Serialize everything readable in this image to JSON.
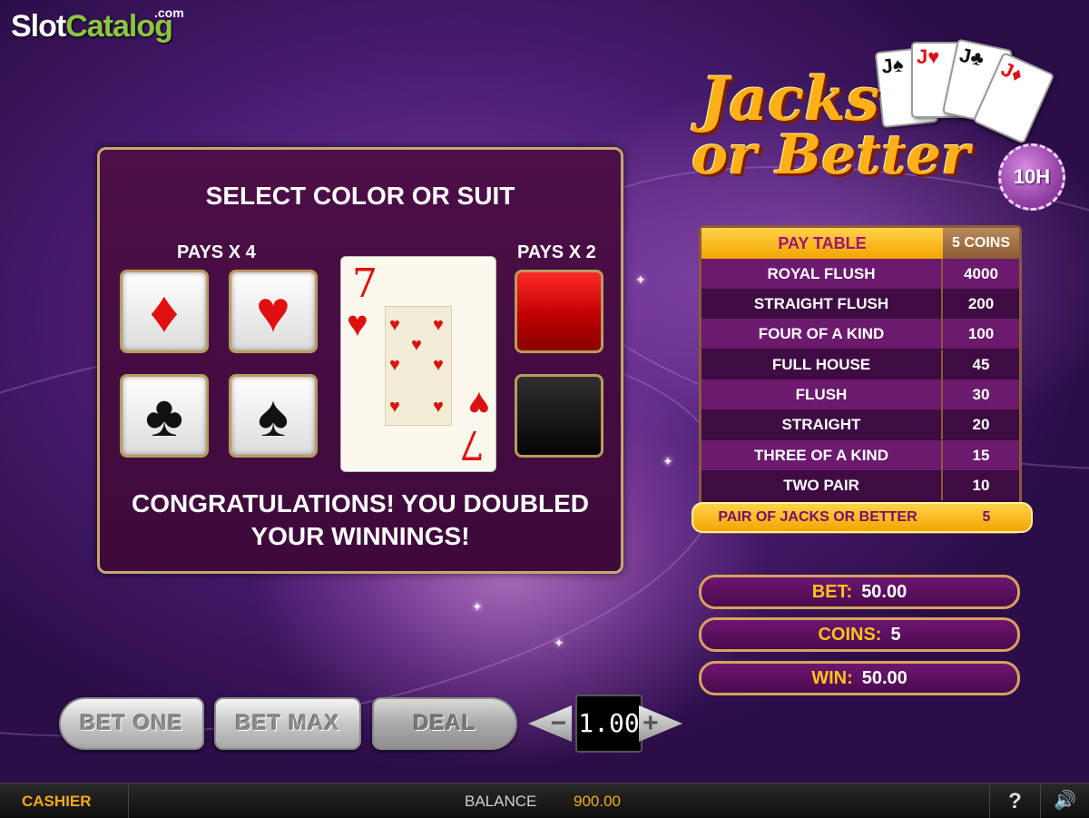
{
  "branding": {
    "logo_part1": "Slot",
    "logo_part2": "Catalog",
    "logo_suffix": ".com"
  },
  "game": {
    "title_line1": "Jacks",
    "title_line2": "or Better",
    "badge": "10H",
    "fan_card_ranks": [
      "J",
      "J",
      "J",
      "J"
    ]
  },
  "double_up": {
    "title": "SELECT COLOR OR SUIT",
    "pays_suit": "PAYS X 4",
    "pays_color": "PAYS X 2",
    "suits": [
      {
        "name": "diamonds",
        "glyph": "♦",
        "color": "#e01010"
      },
      {
        "name": "hearts",
        "glyph": "♥",
        "color": "#e01010"
      },
      {
        "name": "clubs",
        "glyph": "♣",
        "color": "#111111"
      },
      {
        "name": "spades",
        "glyph": "♠",
        "color": "#111111"
      }
    ],
    "colors": [
      {
        "name": "red",
        "hex": "#d80000"
      },
      {
        "name": "black",
        "hex": "#0a0a0a"
      }
    ],
    "card": {
      "rank": "7",
      "suit_glyph": "♥",
      "suit": "hearts"
    },
    "message": "CONGRATULATIONS! YOU DOUBLED YOUR WINNINGS!"
  },
  "paytable": {
    "header_name": "PAY TABLE",
    "header_coins": "5 COINS",
    "rows": [
      {
        "hand": "ROYAL FLUSH",
        "pay": "4000"
      },
      {
        "hand": "STRAIGHT FLUSH",
        "pay": "200"
      },
      {
        "hand": "FOUR OF A KIND",
        "pay": "100"
      },
      {
        "hand": "FULL HOUSE",
        "pay": "45"
      },
      {
        "hand": "FLUSH",
        "pay": "30"
      },
      {
        "hand": "STRAIGHT",
        "pay": "20"
      },
      {
        "hand": "THREE OF A KIND",
        "pay": "15"
      },
      {
        "hand": "TWO PAIR",
        "pay": "10"
      }
    ],
    "highlight": {
      "hand": "PAIR OF  JACKS OR BETTER",
      "pay": "5"
    }
  },
  "info": {
    "bet_label": "BET:",
    "bet_value": "50.00",
    "coins_label": "COINS:",
    "coins_value": "5",
    "win_label": "WIN:",
    "win_value": "50.00"
  },
  "controls": {
    "bet_one": "BET ONE",
    "bet_max": "BET MAX",
    "deal": "DEAL",
    "coin_value": "1.00",
    "minus": "−",
    "plus": "+"
  },
  "bottom_bar": {
    "cashier": "CASHIER",
    "balance_label": "BALANCE",
    "balance_value": "900.00",
    "help": "?",
    "sound_icon": "speaker-icon"
  },
  "colors": {
    "accent_gold": "#ffc21a",
    "paytable_highlight": "#f3a500",
    "panel_border": "#c5a96a"
  }
}
